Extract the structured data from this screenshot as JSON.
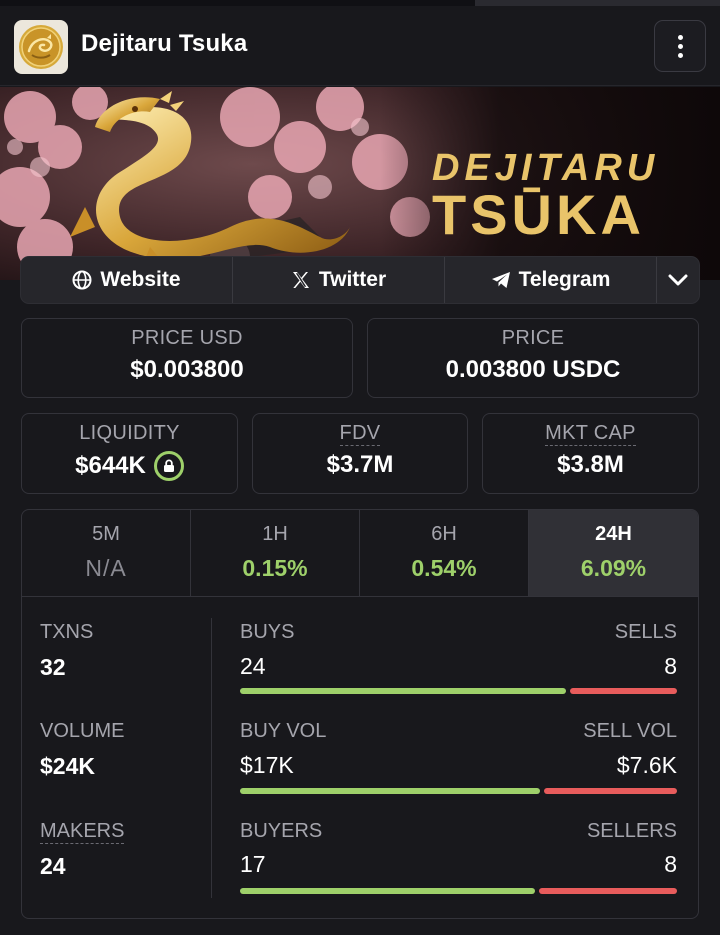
{
  "header": {
    "token_name": "Dejitaru Tsuka",
    "logo_icon": "dragon-coin-logo",
    "menu_icon": "kebab-menu-icon"
  },
  "banner": {
    "title_line1": "DEJITARU",
    "title_line2": "TSŪKA",
    "image": "golden-dragon-cherry-blossom"
  },
  "links": {
    "website": "Website",
    "twitter": "Twitter",
    "telegram": "Telegram",
    "website_icon": "globe-icon",
    "twitter_icon": "x-logo-icon",
    "telegram_icon": "paper-plane-icon",
    "more_icon": "chevron-down-icon"
  },
  "prices": {
    "price_usd_label": "PRICE USD",
    "price_usd_value": "$0.003800",
    "price_label": "PRICE",
    "price_value": "0.003800 USDC"
  },
  "metrics": {
    "liquidity_label": "LIQUIDITY",
    "liquidity_value": "$644K",
    "fdv_label": "FDV",
    "fdv_value": "$3.7M",
    "mktcap_label": "MKT CAP",
    "mktcap_value": "$3.8M"
  },
  "tabs": [
    {
      "label": "5M",
      "value": "N/A"
    },
    {
      "label": "1H",
      "value": "0.15%"
    },
    {
      "label": "6H",
      "value": "0.54%"
    },
    {
      "label": "24H",
      "value": "6.09%"
    }
  ],
  "active_tab": "24H",
  "stats": {
    "txns_label": "TXNS",
    "txns_value": "32",
    "volume_label": "VOLUME",
    "volume_value": "$24K",
    "makers_label": "MAKERS",
    "makers_value": "24",
    "buys_label": "BUYS",
    "buys_value": "24",
    "sells_label": "SELLS",
    "sells_value": "8",
    "buy_vol_label": "BUY VOL",
    "buy_vol_value": "$17K",
    "sell_vol_label": "SELL VOL",
    "sell_vol_value": "$7.6K",
    "buyers_label": "BUYERS",
    "buyers_value": "17",
    "sellers_label": "SELLERS",
    "sellers_value": "8"
  },
  "ratio_bars": {
    "txns_buy_fraction": 0.75,
    "volume_buy_fraction": 0.69,
    "makers_buy_fraction": 0.68
  },
  "colors": {
    "background": "#18181c",
    "positive": "#9ed06a",
    "negative": "#e85c5c",
    "muted_text": "#a5a5ad",
    "gold": "#e9c46a"
  }
}
